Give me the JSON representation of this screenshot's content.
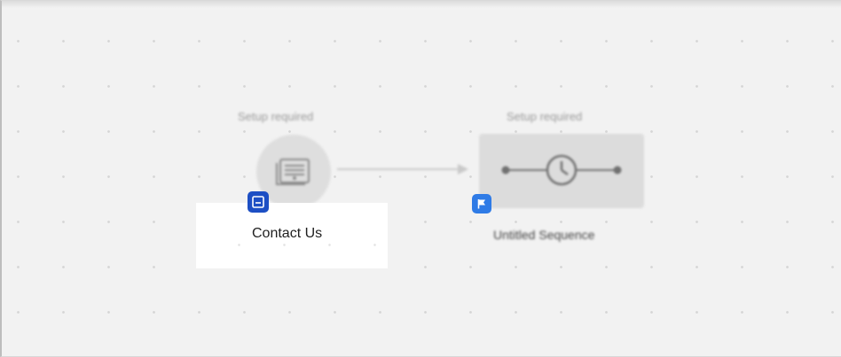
{
  "workflow": {
    "nodes": [
      {
        "status": "Setup required",
        "title": "Contact Us",
        "type_icon": "form-icon",
        "node_icon": "form-document-icon"
      },
      {
        "status": "Setup required",
        "title": "Untitled Sequence",
        "type_icon": "flag-icon",
        "node_icon": "sequence-timer-icon"
      }
    ],
    "connector": "arrow-right",
    "colors": {
      "canvas": "#f2f2f2",
      "form_badge": "#1d4fc4",
      "flag_badge": "#2f7be6",
      "node_fill": "#dedede",
      "grid_dot": "#d6d6d6"
    }
  }
}
